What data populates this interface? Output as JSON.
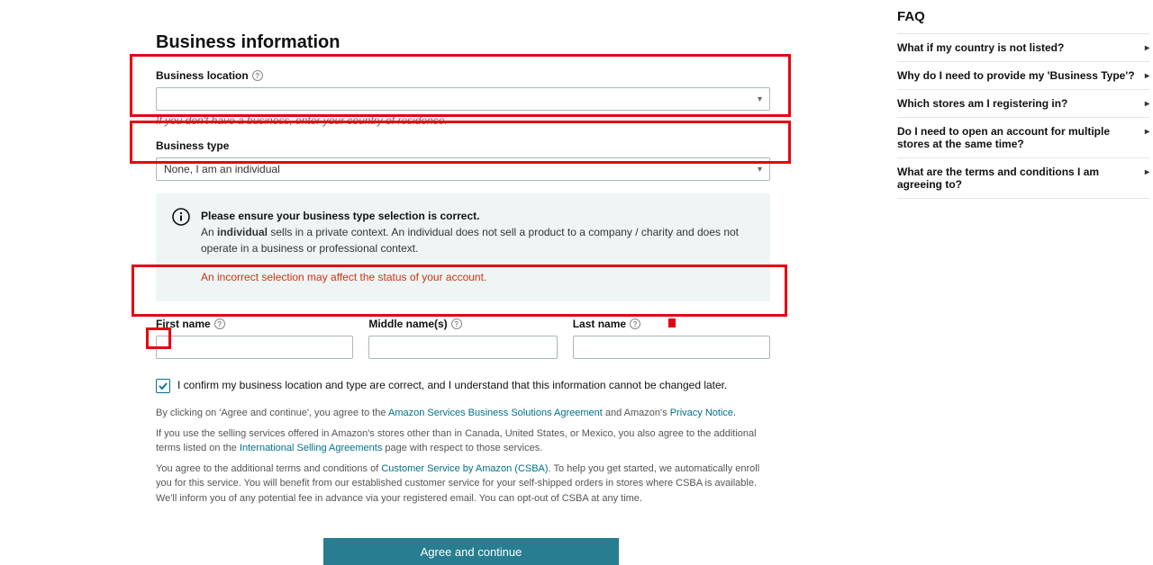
{
  "header": {
    "title": "Business information"
  },
  "location": {
    "label": "Business location",
    "value": "",
    "helper": "If you don't have a business, enter your country of residence."
  },
  "type": {
    "label": "Business type",
    "value": "None, I am an individual"
  },
  "info": {
    "title": "Please ensure your business type selection is correct.",
    "line_prefix": "An ",
    "line_bold": "individual",
    "line_rest": " sells in a private context. An individual does not sell a product to a company / charity and does not operate in a business or professional context.",
    "warning": "An incorrect selection may affect the status of your account."
  },
  "name": {
    "first_label": "First name",
    "middle_label": "Middle name(s)",
    "last_label": "Last name",
    "first": "",
    "middle": "",
    "last": ""
  },
  "confirm": {
    "text": "I confirm my business location and type are correct, and I understand that this information cannot be changed later.",
    "checked": true
  },
  "legal": {
    "p1a": "By clicking on 'Agree and continue', you agree to the ",
    "p1_link1": "Amazon Services Business Solutions Agreement",
    "p1b": " and Amazon's ",
    "p1_link2": "Privacy Notice",
    "p1c": ".",
    "p2a": "If you use the selling services offered in Amazon's stores other than in Canada, United States, or Mexico, you also agree to the additional terms listed on the ",
    "p2_link": "International Selling Agreements",
    "p2b": " page with respect to those services.",
    "p3a": "You agree to the additional terms and conditions of ",
    "p3_link": "Customer Service by Amazon (CSBA)",
    "p3b": ". To help you get started, we automatically enroll you for this service. You will benefit from our established customer service for your self-shipped orders in stores where CSBA is available. We'll inform you of any potential fee in advance via your registered email. You can opt-out of CSBA at any time."
  },
  "cta": {
    "agree": "Agree and continue"
  },
  "faq": {
    "title": "FAQ",
    "items": [
      "What if my country is not listed?",
      "Why do I need to provide my 'Business Type'?",
      "Which stores am I registering in?",
      "Do I need to open an account for multiple stores at the same time?",
      "What are the terms and conditions I am agreeing to?"
    ]
  }
}
